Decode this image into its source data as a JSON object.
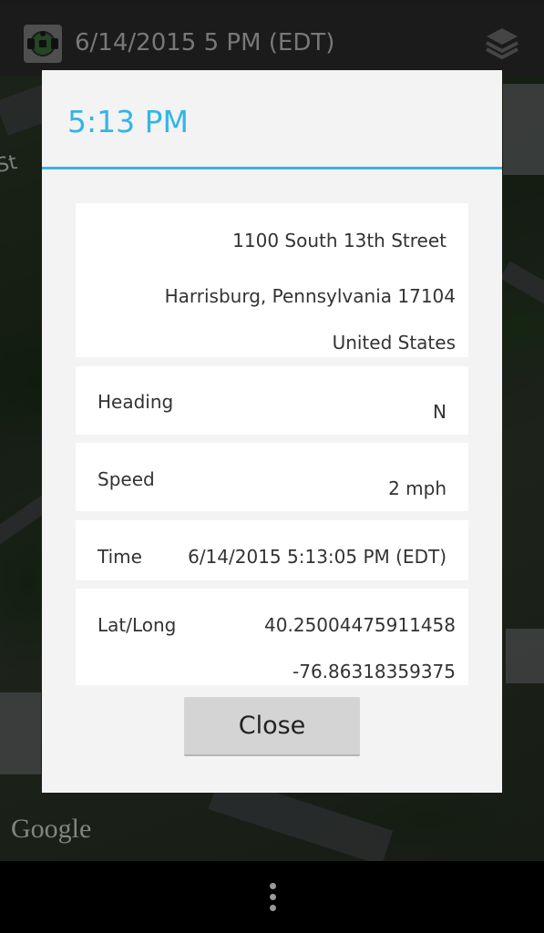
{
  "topbar": {
    "title": "6/14/2015 5 PM (EDT)",
    "app_icon": "app-logo-icon",
    "layers_icon": "layers-icon"
  },
  "map": {
    "street_label": "St",
    "attribution": "Google"
  },
  "dialog": {
    "title": "5:13 PM",
    "accent_color": "#33b5e5",
    "address": {
      "line1": "1100 South 13th Street",
      "line2": "Harrisburg, Pennsylvania 17104",
      "line3": "United States"
    },
    "heading": {
      "label": "Heading",
      "value": "N"
    },
    "speed": {
      "label": "Speed",
      "value": "2 mph"
    },
    "time": {
      "label": "Time",
      "value": "6/14/2015 5:13:05 PM (EDT)"
    },
    "latlong": {
      "label": "Lat/Long",
      "lat": "40.25004475911458",
      "long": "-76.86318359375"
    },
    "close_label": "Close"
  },
  "navbar": {
    "overflow_icon": "overflow-menu-icon"
  }
}
